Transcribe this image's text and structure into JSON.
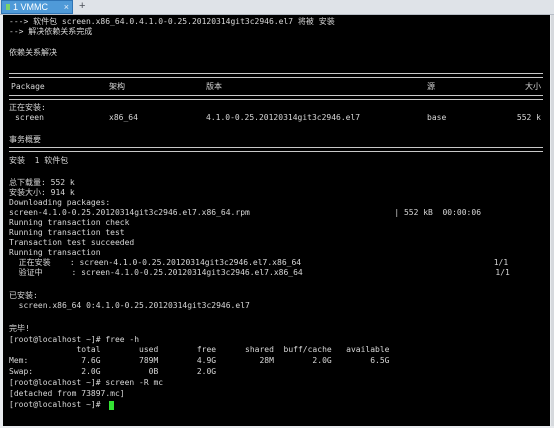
{
  "tabs": [
    {
      "label": "1 VMMC",
      "close": "×"
    }
  ],
  "new_tab": "+",
  "terminal": {
    "head": [
      "---> 软件包 screen.x86_64.0.4.1.0-0.25.20120314git3c2946.el7 将被 安装",
      "--> 解决依赖关系完成",
      "",
      "依赖关系解决"
    ],
    "table": {
      "headers": [
        "Package",
        "架构",
        "版本",
        "源",
        "大小"
      ],
      "section": "正在安装:",
      "row": [
        "screen",
        "x86_64",
        "4.1.0-0.25.20120314git3c2946.el7",
        "base",
        "552 k"
      ]
    },
    "summary_title": "事务概要",
    "install_summary": "安装  1 软件包",
    "body": [
      "总下载量: 552 k",
      "安装大小: 914 k",
      "Downloading packages:",
      "screen-4.1.0-0.25.20120314git3c2946.el7.x86_64.rpm                              | 552 kB  00:00:06",
      "Running transaction check",
      "Running transaction test",
      "Transaction test succeeded",
      "Running transaction",
      "  正在安装    : screen-4.1.0-0.25.20120314git3c2946.el7.x86_64                                        1/1",
      "  验证中      : screen-4.1.0-0.25.20120314git3c2946.el7.x86_64                                        1/1",
      "",
      "已安装:",
      "  screen.x86_64 0:4.1.0-0.25.20120314git3c2946.el7",
      "",
      "完毕!",
      "[root@localhost ~]# free -h",
      "              total        used        free      shared  buff/cache   available",
      "Mem:           7.6G        789M        4.9G         28M        2.0G        6.5G",
      "Swap:          2.0G          0B        2.0G",
      "[root@localhost ~]# screen -R mc",
      "[detached from 73897.mc]"
    ],
    "prompt": "[root@localhost ~]# "
  },
  "colors": {
    "terminal_bg": "#000000",
    "terminal_fg": "#d7d7d7",
    "cursor": "#33e233",
    "tab_bg": "#4f9ad8"
  }
}
